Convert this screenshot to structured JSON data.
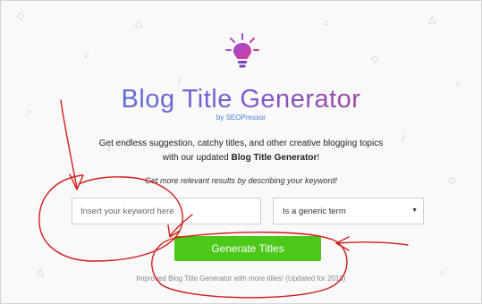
{
  "header": {
    "icon": "lightbulb-icon",
    "title": "Blog Title Generator",
    "byline": "by SEOPressor"
  },
  "intro": {
    "line1": "Get endless suggestion, catchy titles, and other creative blogging topics",
    "line2_prefix": "with our updated ",
    "line2_bold": "Blog Title Generator",
    "line2_suffix": "!"
  },
  "hint": "Get more relevant results by describing your keyword!",
  "form": {
    "keyword_placeholder": "Insert your keyword here",
    "keyword_value": "",
    "select_value": "Is a generic term",
    "submit_label": "Generate Titles"
  },
  "footer_note": "Improved Blog Title Generator with more titles! (Updated for 2018)",
  "colors": {
    "title_gradient_start": "#3f7fe0",
    "title_gradient_end": "#c0356b",
    "button": "#4bc81a",
    "annotation": "#d21c1c"
  }
}
